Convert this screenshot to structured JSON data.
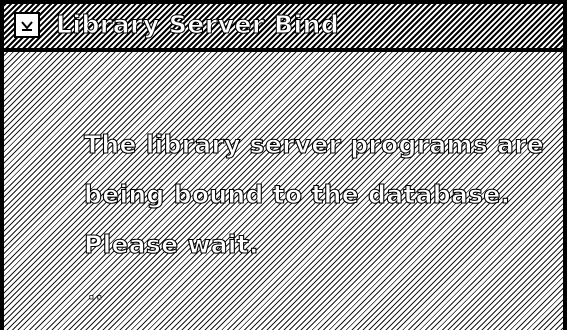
{
  "window": {
    "title": "Library Server Bind",
    "system_menu_icon": "system-menu-icon"
  },
  "message": {
    "line1": "The library server programs are",
    "line2": "being bound to the database.",
    "line3": "Please wait.",
    "progress": ".."
  },
  "colors": {
    "border": "#000000",
    "background": "#ffffff",
    "pattern": "#000000"
  }
}
